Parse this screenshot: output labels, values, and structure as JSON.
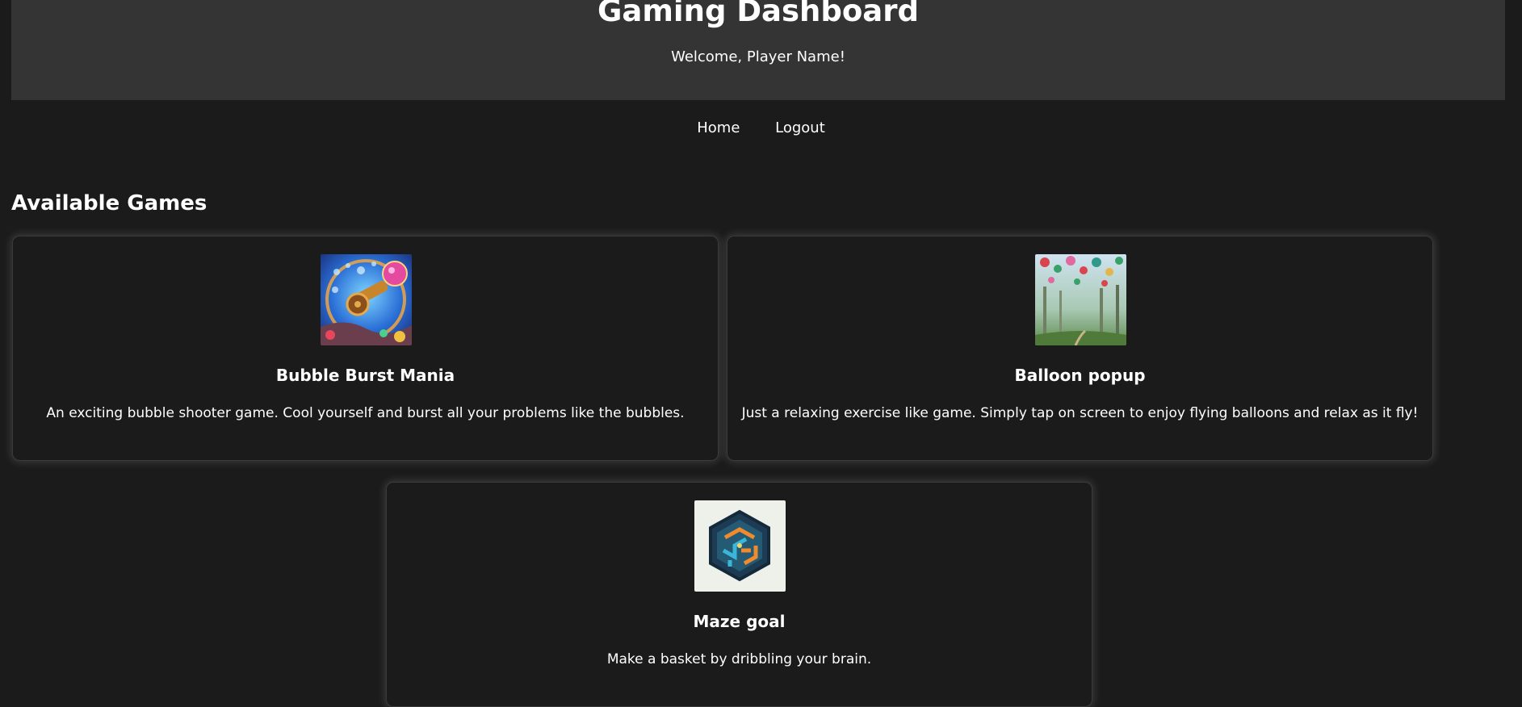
{
  "header": {
    "title": "Gaming Dashboard",
    "welcome": "Welcome, Player Name!"
  },
  "nav": {
    "items": [
      {
        "label": "Home"
      },
      {
        "label": "Logout"
      }
    ]
  },
  "main": {
    "section_title": "Available Games",
    "games": [
      {
        "title": "Bubble Burst Mania",
        "description": "An exciting bubble shooter game. Cool yourself and burst all your problems like the bubbles.",
        "icon": "bubble-cannon-image"
      },
      {
        "title": "Balloon popup",
        "description": "Just a relaxing exercise like game. Simply tap on screen to enjoy flying balloons and relax as it fly!",
        "icon": "balloon-forest-image"
      },
      {
        "title": "Maze goal",
        "description": "Make a basket by dribbling your brain.",
        "icon": "hex-maze-image"
      }
    ]
  },
  "colors": {
    "background": "#1b1b1b",
    "header_background": "#343434",
    "text": "#ffffff"
  }
}
